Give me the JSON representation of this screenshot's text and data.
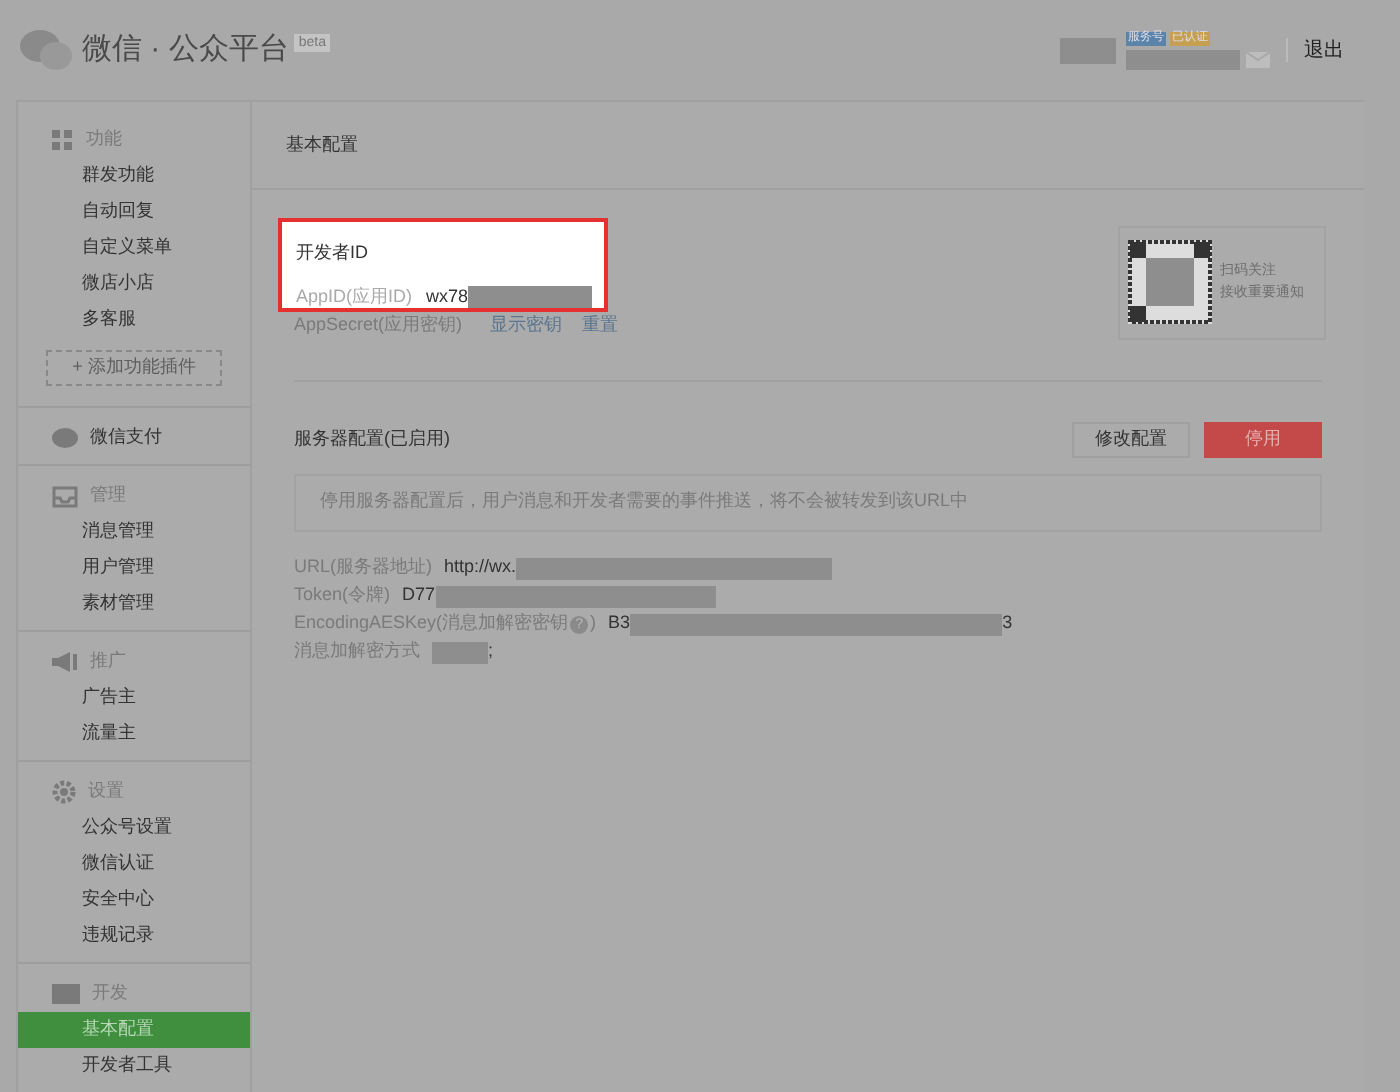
{
  "header": {
    "title": "微信 · 公众平台",
    "beta": "beta",
    "badges": [
      {
        "label": "服务号",
        "color": "#5b84a8"
      },
      {
        "label": "已认证",
        "color": "#c4a050"
      }
    ],
    "logout": "退出"
  },
  "sidebar": [
    {
      "title": "功能",
      "items": [
        {
          "label": "群发功能",
          "selected": false
        },
        {
          "label": "自动回复",
          "selected": false
        },
        {
          "label": "自定义菜单",
          "selected": false
        },
        {
          "label": "微店小店",
          "selected": false
        },
        {
          "label": "多客服",
          "selected": false
        }
      ],
      "add_plugin": "+ 添加功能插件"
    },
    {
      "title": "微信支付"
    },
    {
      "title": "管理",
      "items": [
        {
          "label": "消息管理",
          "selected": false
        },
        {
          "label": "用户管理",
          "selected": false
        },
        {
          "label": "素材管理",
          "selected": false
        }
      ]
    },
    {
      "title": "推广",
      "items": [
        {
          "label": "广告主",
          "selected": false
        },
        {
          "label": "流量主",
          "selected": false
        }
      ]
    },
    {
      "title": "设置",
      "items": [
        {
          "label": "公众号设置",
          "selected": false
        },
        {
          "label": "微信认证",
          "selected": false
        },
        {
          "label": "安全中心",
          "selected": false
        },
        {
          "label": "违规记录",
          "selected": false
        }
      ]
    },
    {
      "title": "开发",
      "items": [
        {
          "label": "基本配置",
          "selected": true
        },
        {
          "label": "开发者工具",
          "selected": false
        }
      ]
    }
  ],
  "page_title": "基本配置",
  "developer": {
    "title": "开发者ID",
    "appid_label": "AppID(应用ID)",
    "appid_value": "wx78",
    "secret_label": "AppSecret(应用密钥)",
    "secret_links": [
      "显示密钥",
      "重置"
    ]
  },
  "qr": {
    "lines": [
      "扫码关注",
      "接收重要通知"
    ]
  },
  "server": {
    "title": "服务器配置(已启用)",
    "buttons": [
      {
        "label": "修改配置",
        "kind": "plain"
      },
      {
        "label": "停用",
        "kind": "danger"
      }
    ],
    "notice": "停用服务器配置后，用户消息和开发者需要的事件推送，将不会被转发到该URL中",
    "fields": [
      {
        "label": "URL(服务器地址)",
        "value": "http://wx."
      },
      {
        "label": "Token(令牌)",
        "value": "D77"
      },
      {
        "label": "EncodingAESKey(消息加解密密钥",
        "help": "?",
        "label_end": ")",
        "value": "B3",
        "suffix": "3"
      },
      {
        "label": "消息加解密方式",
        "suffix": ";"
      }
    ]
  }
}
